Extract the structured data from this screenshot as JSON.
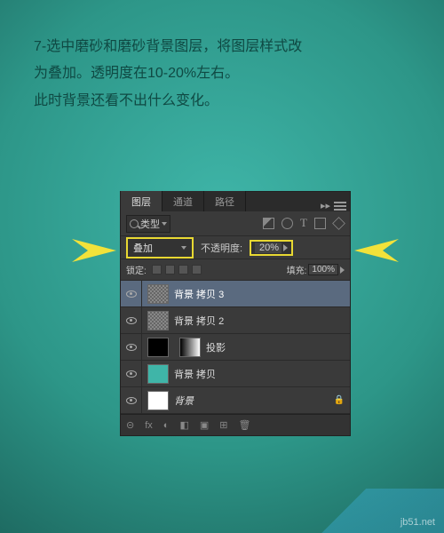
{
  "instructions": {
    "line1": "7-选中磨砂和磨砂背景图层，将图层样式改",
    "line2": "为叠加。透明度在10-20%左右。",
    "line3": "此时背景还看不出什么变化。"
  },
  "panel": {
    "tabs": {
      "layers": "图层",
      "channels": "通道",
      "paths": "路径"
    },
    "row1": {
      "kind": "类型"
    },
    "row2": {
      "blend": "叠加",
      "opacity_label": "不透明度:",
      "opacity_value": "20%"
    },
    "row3": {
      "lock_label": "锁定:",
      "fill_label": "填充:",
      "fill_value": "100%"
    },
    "layers": [
      {
        "name": "背景 拷贝 3",
        "thumb": "noise",
        "sel": true
      },
      {
        "name": "背景 拷贝 2",
        "thumb": "noise"
      },
      {
        "name": "投影",
        "thumb": "black",
        "mask": true
      },
      {
        "name": "背景 拷贝",
        "thumb": "teal"
      },
      {
        "name": "背景",
        "thumb": "white",
        "locked": true,
        "italic": true
      }
    ],
    "bottom_icons": [
      "⊝",
      "fx",
      "◐",
      "◧",
      "▣",
      "⊞",
      "🗑"
    ]
  },
  "watermark": "jb51.net"
}
